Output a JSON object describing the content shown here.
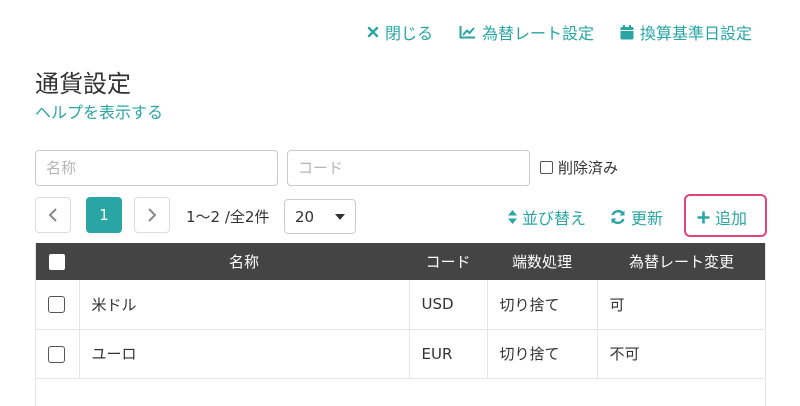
{
  "top_actions": {
    "close_label": "閉じる",
    "rate_settings_label": "為替レート設定",
    "base_date_label": "換算基準日設定"
  },
  "page": {
    "title": "通貨設定",
    "help_link": "ヘルプを表示する"
  },
  "filters": {
    "name_placeholder": "名称",
    "code_placeholder": "コード",
    "deleted_label": "削除済み"
  },
  "pagination": {
    "current_page": "1",
    "info": "1〜2 /全2件",
    "page_size": "20"
  },
  "list_actions": {
    "sort_label": "並び替え",
    "refresh_label": "更新",
    "add_label": "追加"
  },
  "colors": {
    "accent": "#2aa5a5",
    "header_bg": "#444444",
    "highlight": "#e0457a"
  },
  "table": {
    "headers": {
      "name": "名称",
      "code": "コード",
      "rounding": "端数処理",
      "rate_change": "為替レート変更"
    },
    "rows": [
      {
        "name": "米ドル",
        "code": "USD",
        "rounding": "切り捨て",
        "rate_change": "可"
      },
      {
        "name": "ユーロ",
        "code": "EUR",
        "rounding": "切り捨て",
        "rate_change": "不可"
      }
    ]
  }
}
